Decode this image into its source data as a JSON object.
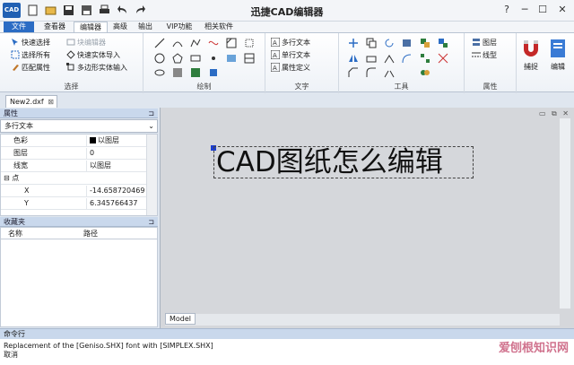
{
  "window": {
    "title": "迅捷CAD编辑器",
    "app_icon_label": "CAD",
    "minimize": "─",
    "maximize": "☐",
    "close": "✕",
    "help": "?"
  },
  "ribbon_tabs": [
    {
      "label": "文件"
    },
    {
      "label": "查看器"
    },
    {
      "label": "编辑器"
    },
    {
      "label": "高级"
    },
    {
      "label": "输出"
    },
    {
      "label": "VIP功能"
    },
    {
      "label": "相关软件"
    }
  ],
  "ribbon": {
    "select_group": {
      "title": "选择",
      "items": [
        "快速选择",
        "选择所有",
        "匹配属性"
      ]
    },
    "block_group": {
      "items": [
        "块编辑器",
        "快速实体导入",
        "多边形实体输入"
      ]
    },
    "draw_group": {
      "title": "绘制"
    },
    "text_group": {
      "title": "文字",
      "items": [
        "多行文本",
        "单行文本",
        "属性定义"
      ]
    },
    "tools_group": {
      "title": "工具"
    },
    "props_group": {
      "title": "属性",
      "items": [
        "图层",
        "线型"
      ]
    },
    "snap_label": "捕捉",
    "edit_label": "编辑"
  },
  "document_tab": {
    "label": "New2.dxf",
    "close": "⊠"
  },
  "properties_panel": {
    "title": "属性",
    "selected_type": "多行文本",
    "rows": [
      {
        "key": "色彩",
        "value": "以图层"
      },
      {
        "key": "图层",
        "value": "0"
      },
      {
        "key": "线宽",
        "value": "以图层"
      },
      {
        "key": "点",
        "value": ""
      },
      {
        "key": "X",
        "value": "-14.658720469"
      },
      {
        "key": "Y",
        "value": "6.345766437"
      }
    ],
    "point_toggle": "⊟"
  },
  "favorites_panel": {
    "title": "收藏夹",
    "columns": [
      "名称",
      "路径"
    ]
  },
  "drawing": {
    "text": "CAD图纸怎么编辑",
    "model_tab": "Model"
  },
  "command_panel": {
    "title": "命令行",
    "lines": [
      "Replacement of the [Geniso.SHX] font with [SIMPLEX.SHX]",
      "取消"
    ]
  },
  "watermark": "爱刨根知识网",
  "colors": {
    "file_tab": "#2b6cc4",
    "panel_title": "#c9d8ec",
    "canvas": "#d5d7db",
    "grip": "#1d3fd1"
  }
}
